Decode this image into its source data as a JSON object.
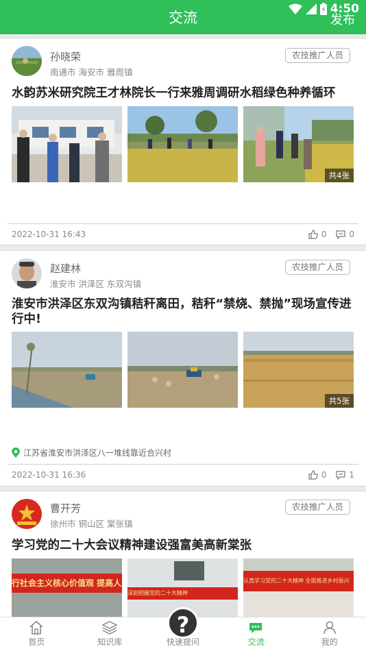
{
  "status_bar": {
    "time": "4:50"
  },
  "header": {
    "title": "交流",
    "publish_label": "发布"
  },
  "posts": [
    {
      "author": "孙晓荣",
      "region": "南通市 海安市 雅周镇",
      "role": "农技推广人员",
      "title": "水韵苏米研究院王才林院长一行来雅周调研水稻绿色种养循环",
      "image_count": "共4张",
      "time": "2022-10-31 16:43",
      "likes": "0",
      "comments": "0"
    },
    {
      "author": "赵建林",
      "region": "淮安市 洪泽区 东双沟镇",
      "role": "农技推广人员",
      "title": "淮安市洪泽区东双沟镇秸秆离田，秸秆“禁烧、禁抛”现场宣传进行中!",
      "image_count": "共5张",
      "location": "江苏省淮安市洪泽区八一堆线靠近合兴村",
      "time": "2022-10-31 16:36",
      "likes": "0",
      "comments": "1"
    },
    {
      "author": "曹开芳",
      "region": "徐州市 铜山区 棠张镇",
      "role": "农技推广人员",
      "title": "学习党的二十大会议精神建设强富美高新棠张",
      "banner_texts": [
        "行社会主义核心价值观  提高人民道德水准",
        "深刻把握党的二十大精神",
        "认真学习党的二十大精神  全面推进乡村振兴"
      ]
    }
  ],
  "nav": [
    {
      "label": "首页",
      "icon": "home-icon"
    },
    {
      "label": "知识库",
      "icon": "layers-icon"
    },
    {
      "label": "快速提问",
      "icon": "question-icon"
    },
    {
      "label": "交流",
      "icon": "chat-icon"
    },
    {
      "label": "我的",
      "icon": "person-icon"
    }
  ],
  "colors": {
    "brand": "#2fc05a"
  }
}
